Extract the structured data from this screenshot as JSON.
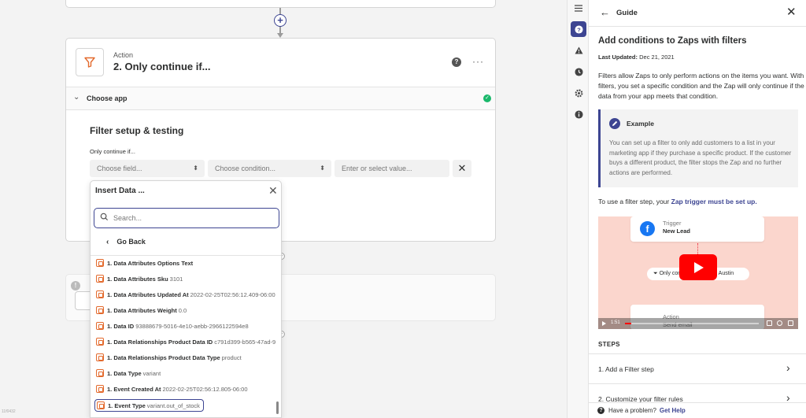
{
  "canvas": {
    "add_step_symbol": "+",
    "action_step": {
      "kind": "Action",
      "title": "2. Only continue if...",
      "section_title": "Choose app",
      "filter_title": "Filter setup & testing",
      "condition_label": "Only continue if...",
      "field_placeholder": "Choose field...",
      "condition_placeholder": "Choose condition...",
      "value_placeholder": "Enter or select value..."
    },
    "corner_id": "11f0432"
  },
  "dropdown": {
    "title": "Insert Data ...",
    "search_placeholder": "Search...",
    "back_label": "Go Back",
    "items": [
      {
        "label": "1. Data Attributes Options Text",
        "value": ""
      },
      {
        "label": "1. Data Attributes Sku",
        "value": "3101"
      },
      {
        "label": "1. Data Attributes Updated At",
        "value": "2022-02-25T02:56:12.409-06:00"
      },
      {
        "label": "1. Data Attributes Weight",
        "value": "0.0"
      },
      {
        "label": "1. Data ID",
        "value": "93888679-5016-4e10-aebb-2966122594e8"
      },
      {
        "label": "1. Data Relationships Product Data ID",
        "value": "c791d399-b565-47ad-9"
      },
      {
        "label": "1. Data Relationships Product Data Type",
        "value": "product"
      },
      {
        "label": "1. Data Type",
        "value": "variant"
      },
      {
        "label": "1. Event Created At",
        "value": "2022-02-25T02:56:12.805-06:00"
      },
      {
        "label": "1. Event Type",
        "value": "variant.out_of_stock"
      }
    ]
  },
  "guide": {
    "header_title": "Guide",
    "title": "Add conditions to Zaps with filters",
    "updated_label": "Last Updated:",
    "updated_date": "Dec 21, 2021",
    "intro": "Filters allow Zaps to only perform actions on the items you want. With filters, you set a specific condition and the Zap will only continue if the data from your app meets that condition.",
    "example_title": "Example",
    "example_text": "You can set up a filter to only add customers to a list in your marketing app if they purchase a specific product. If the customer buys a different product, the filter stops the Zap and no further actions are performed.",
    "trigger_prefix": "To use a filter step, your",
    "trigger_link": "Zap trigger must be set up.",
    "video": {
      "trigger_kind": "Trigger",
      "trigger_name": "New Lead",
      "filter_text": "Only continue if city is... Austin",
      "action_kind": "Action",
      "action_name": "Send email",
      "time": "1:51"
    },
    "steps_label": "STEPS",
    "steps": [
      "1. Add a Filter step",
      "2. Customize your filter rules"
    ],
    "footer_text": "Have a problem?",
    "footer_link": "Get Help"
  },
  "colors": {
    "accent": "#3d4592",
    "zap_orange": "#e36a2d",
    "success": "#1ab86b",
    "facebook": "#1877f2",
    "video_bg": "#fbd6cd"
  }
}
